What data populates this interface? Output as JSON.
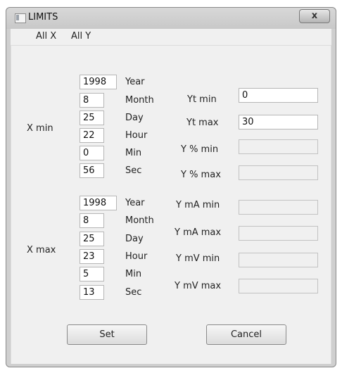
{
  "window": {
    "title": "LIMITS",
    "close_glyph": "x"
  },
  "menu": {
    "items": [
      "All X",
      "All Y"
    ]
  },
  "x_min": {
    "label": "X min",
    "fields": [
      {
        "value": "1998",
        "unit": "Year"
      },
      {
        "value": "8",
        "unit": "Month"
      },
      {
        "value": "25",
        "unit": "Day"
      },
      {
        "value": "22",
        "unit": "Hour"
      },
      {
        "value": "0",
        "unit": "Min"
      },
      {
        "value": "56",
        "unit": "Sec"
      }
    ]
  },
  "x_max": {
    "label": "X max",
    "fields": [
      {
        "value": "1998",
        "unit": "Year"
      },
      {
        "value": "8",
        "unit": "Month"
      },
      {
        "value": "25",
        "unit": "Day"
      },
      {
        "value": "23",
        "unit": "Hour"
      },
      {
        "value": "5",
        "unit": "Min"
      },
      {
        "value": "13",
        "unit": "Sec"
      }
    ]
  },
  "y_limits": [
    {
      "label": "Yt min",
      "value": "0",
      "enabled": true
    },
    {
      "label": "Yt max",
      "value": "30",
      "enabled": true
    },
    {
      "label": "Y % min",
      "value": "",
      "enabled": false
    },
    {
      "label": "Y % max",
      "value": "",
      "enabled": false
    },
    {
      "label": "Y mA min",
      "value": "",
      "enabled": false
    },
    {
      "label": "Y mA max",
      "value": "",
      "enabled": false
    },
    {
      "label": "Y mV min",
      "value": "",
      "enabled": false
    },
    {
      "label": "Y mV max",
      "value": "",
      "enabled": false
    }
  ],
  "buttons": {
    "set": "Set",
    "cancel": "Cancel"
  }
}
